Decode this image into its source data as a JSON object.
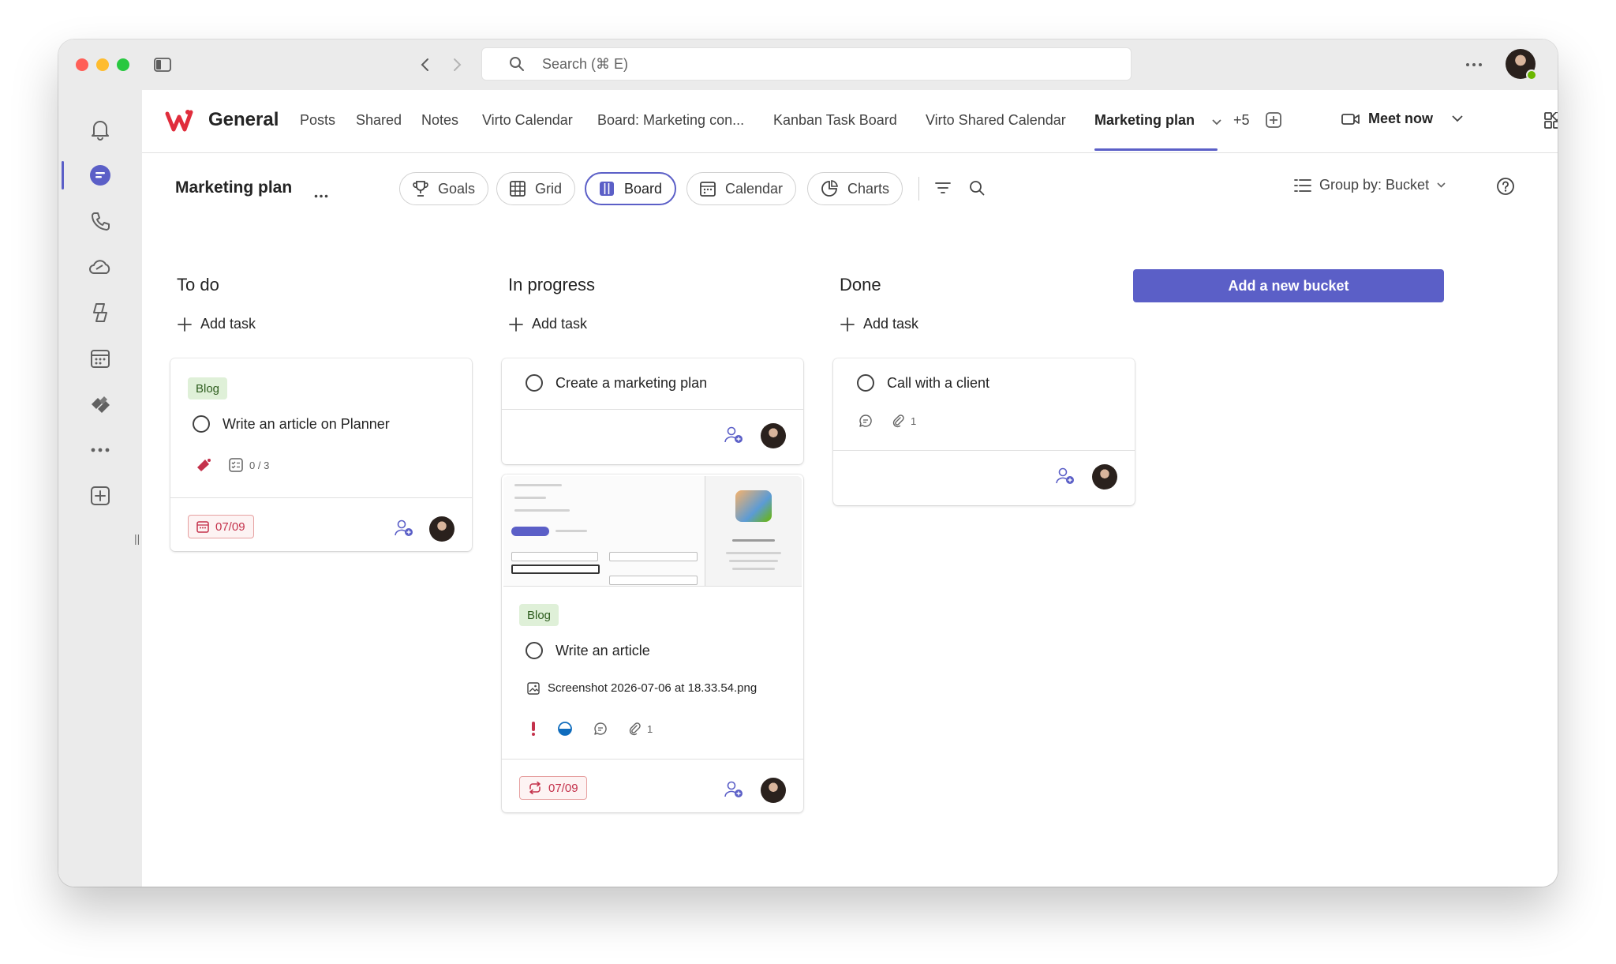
{
  "titlebar": {
    "search_placeholder": "Search (⌘ E)"
  },
  "rail": {
    "items": [
      "activity-icon",
      "chat-icon",
      "calls-icon",
      "onedrive-icon",
      "copilot-icon",
      "calendar-icon",
      "planner-icon",
      "more-apps-icon",
      "add-apps-icon"
    ]
  },
  "channel": {
    "name": "General",
    "tabs": [
      "Posts",
      "Shared",
      "Notes",
      "Virto Calendar",
      "Board: Marketing con...",
      "Kanban Task Board",
      "Virto Shared Calendar",
      "Marketing plan"
    ],
    "more_count": "+5",
    "meet_label": "Meet now"
  },
  "toolbar": {
    "plan_title": "Marketing plan",
    "views": [
      "Goals",
      "Grid",
      "Board",
      "Calendar",
      "Charts"
    ],
    "selected_view": "Board",
    "group_by": "Group by: Bucket"
  },
  "board": {
    "add_bucket_label": "Add a new bucket",
    "add_task_label": "Add task",
    "buckets": [
      {
        "title": "To do",
        "cards": [
          {
            "label": "Blog",
            "title": "Write an article on Planner",
            "checklist": "0 / 3",
            "due": "07/09"
          }
        ]
      },
      {
        "title": "In progress",
        "cards": [
          {
            "title": "Create a marketing plan"
          },
          {
            "label": "Blog",
            "title": "Write an article",
            "attachment": "Screenshot 2026-07-06 at 18.33.54.png",
            "attachments_count": "1",
            "due": "07/09"
          }
        ]
      },
      {
        "title": "Done",
        "cards": [
          {
            "title": "Call with a client",
            "attachments_count": "1"
          }
        ]
      }
    ]
  },
  "colors": {
    "accent": "#5b5fc7",
    "label_bg": "#dff0d8",
    "overdue": "#c4314b"
  }
}
